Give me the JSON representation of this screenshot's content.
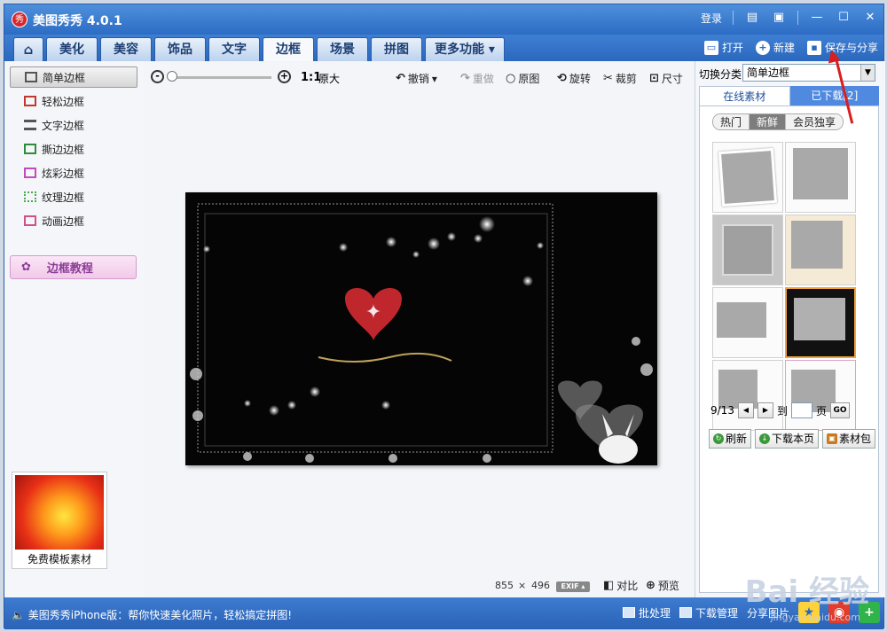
{
  "app": {
    "title": "美图秀秀 4.0.1",
    "logo_text": "秀"
  },
  "titlebar": {
    "login": "登录"
  },
  "tabs": [
    "美化",
    "美容",
    "饰品",
    "文字",
    "边框",
    "场景",
    "拼图"
  ],
  "more_tab": "更多功能",
  "file_actions": {
    "open": "打开",
    "new": "新建",
    "save_share": "保存与分享"
  },
  "left_menu": [
    "简单边框",
    "轻松边框",
    "文字边框",
    "撕边边框",
    "炫彩边框",
    "纹理边框",
    "动画边框"
  ],
  "tutorial": "边框教程",
  "template_label": "免费模板素材",
  "toolbar": {
    "ratio": "1:1",
    "original_size": "原大",
    "undo": "撤销",
    "redo": "重做",
    "original_image": "原图",
    "rotate": "旋转",
    "crop": "裁剪",
    "size": "尺寸"
  },
  "image_info": {
    "width": "855",
    "x": "×",
    "height": "496",
    "exif": "EXIF",
    "compare": "对比",
    "preview": "预览"
  },
  "right_panel": {
    "switch_label": "切换分类",
    "category": "简单边框",
    "tab_online": "在线素材",
    "tab_downloaded": "已下载[2]",
    "subtabs": [
      "热门",
      "新鲜",
      "会员独享"
    ],
    "page_text": "9/13",
    "to": "到",
    "page": "页",
    "go": "GO",
    "refresh": "刷新",
    "download_page": "下载本页",
    "material_pack": "素材包"
  },
  "statusbar": {
    "text": "美图秀秀iPhone版：帮你快速美化照片，轻松搞定拼图!",
    "batch": "批处理",
    "download_manager": "下载管理",
    "share_image": "分享图片"
  },
  "watermark": {
    "brand": "Bai 经验",
    "url": "jingyan.baidu.com"
  },
  "colors": {
    "accent": "#2c6cc4",
    "highlight": "#f0a23c",
    "arrow": "#d81e1e"
  }
}
